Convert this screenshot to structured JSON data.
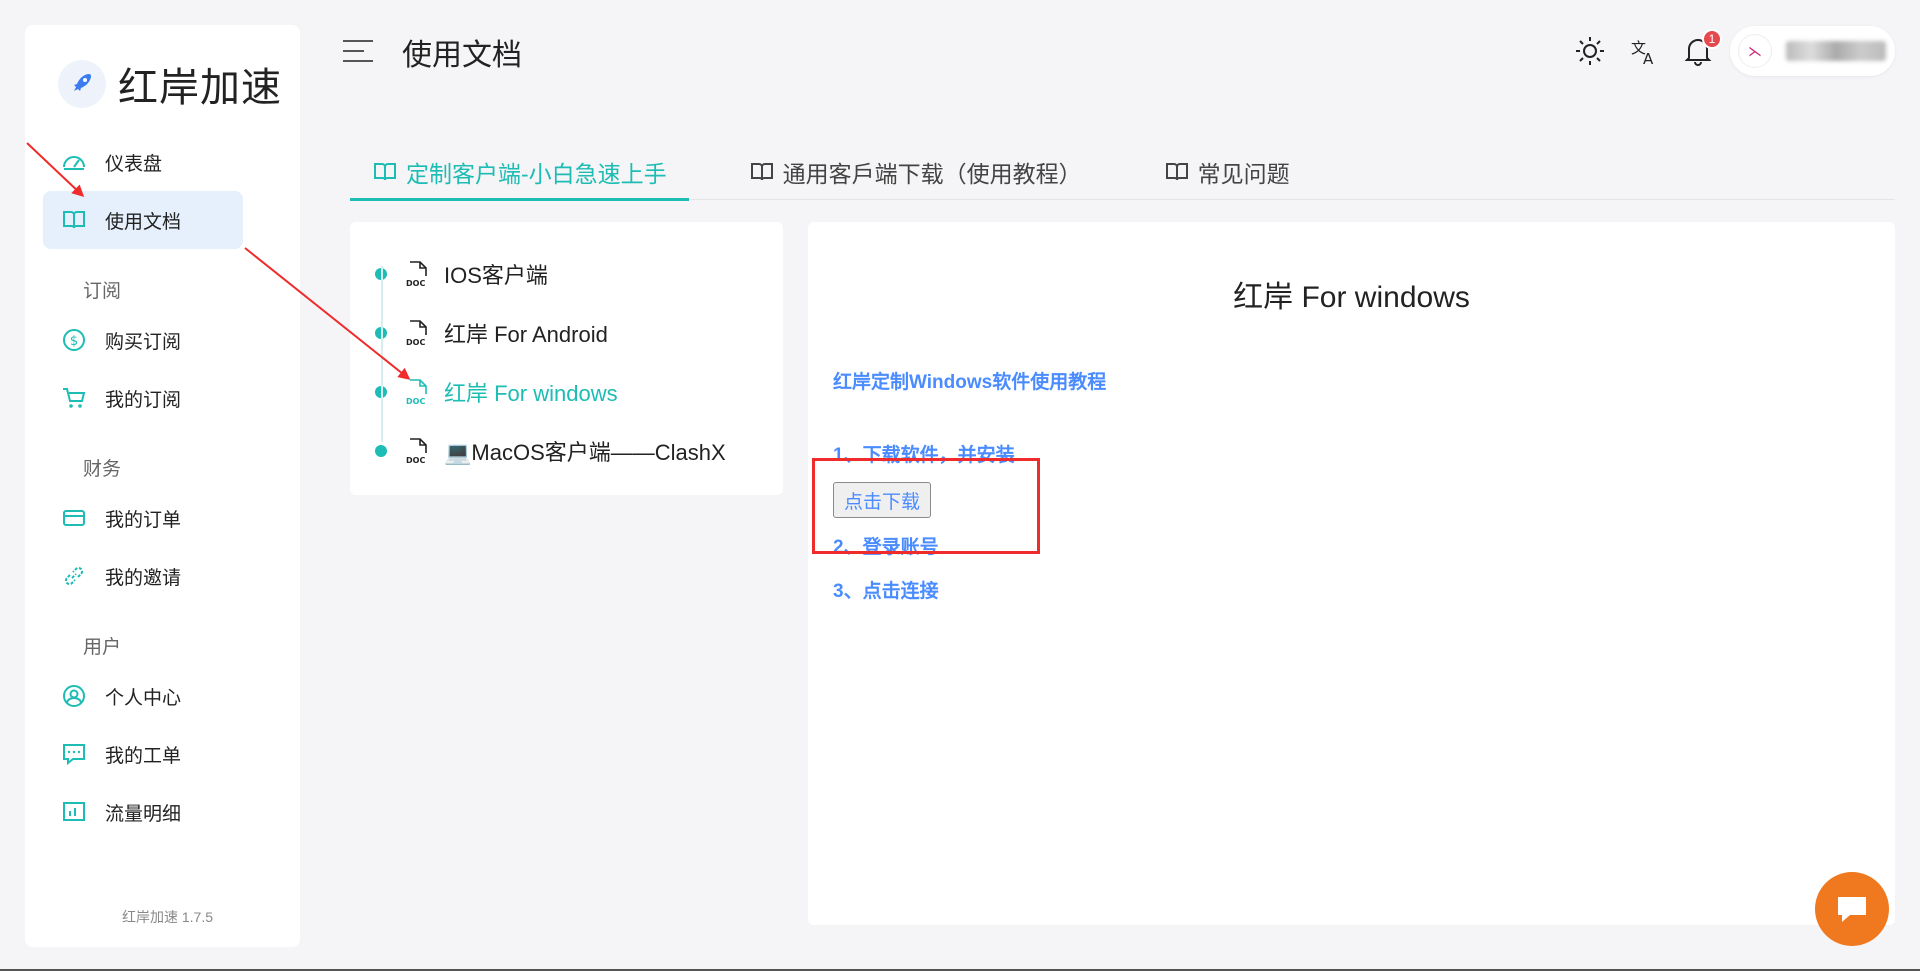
{
  "brand": {
    "name": "红岸加速",
    "version": "红岸加速 1.7.5"
  },
  "header": {
    "title": "使用文档",
    "notification_count": "1"
  },
  "sidebar": {
    "items_top": [
      {
        "label": "仪表盘",
        "icon": "dashboard-icon"
      },
      {
        "label": "使用文档",
        "icon": "book-icon",
        "active": true
      }
    ],
    "sections": [
      {
        "title": "订阅",
        "items": [
          {
            "label": "购买订阅",
            "icon": "dollar-icon"
          },
          {
            "label": "我的订阅",
            "icon": "cart-icon"
          }
        ]
      },
      {
        "title": "财务",
        "items": [
          {
            "label": "我的订单",
            "icon": "wallet-icon"
          },
          {
            "label": "我的邀请",
            "icon": "link-icon"
          }
        ]
      },
      {
        "title": "用户",
        "items": [
          {
            "label": "个人中心",
            "icon": "user-icon"
          },
          {
            "label": "我的工单",
            "icon": "chat-icon"
          },
          {
            "label": "流量明细",
            "icon": "chart-icon"
          }
        ]
      }
    ]
  },
  "tabs": [
    {
      "label": "定制客户端-小白急速上手",
      "active": true
    },
    {
      "label": "通用客戶端下载（使用教程）"
    },
    {
      "label": "常见问题"
    }
  ],
  "docs": [
    {
      "label": "IOS客户端"
    },
    {
      "label": "红岸 For Android"
    },
    {
      "label": "红岸 For windows",
      "active": true
    },
    {
      "label": "💻MacOS客户端——ClashX"
    }
  ],
  "content": {
    "title": "红岸 For windows",
    "heading": "红岸定制Windows软件使用教程",
    "step1": "1、下载软件，并安装",
    "download_button": "点击下载",
    "step2": "2、登录账号",
    "step3": "3、点击连接"
  },
  "colors": {
    "accent": "#1dbcb4",
    "link_blue": "#4a8cff",
    "annotation_red": "#ef2b2b",
    "chat_orange": "#f0781f"
  }
}
